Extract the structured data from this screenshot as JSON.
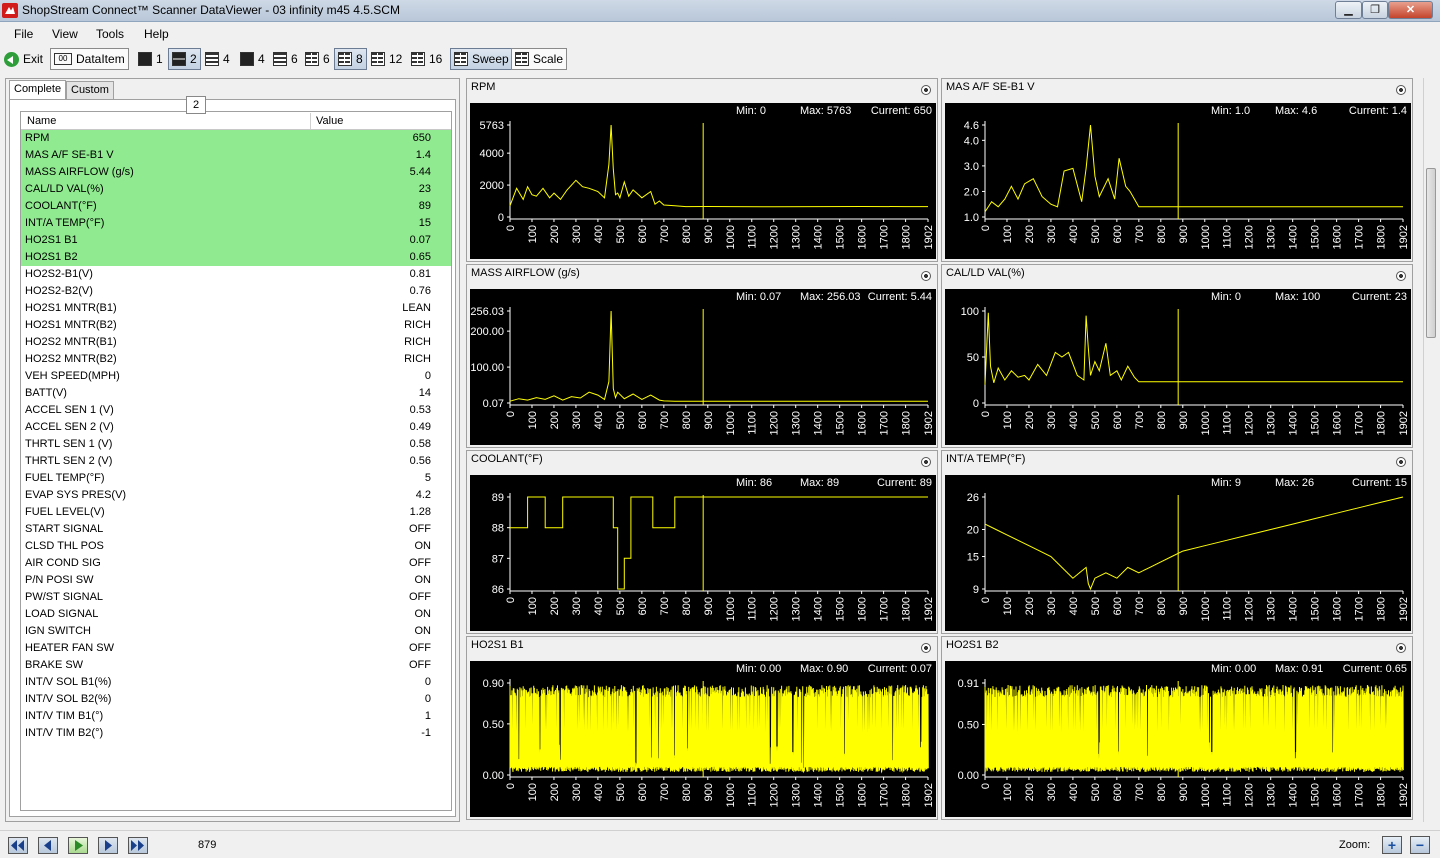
{
  "window": {
    "title": "ShopStream Connect™ Scanner DataViewer - 03 infinity m45 4.5.SCM",
    "min": "▁",
    "max": "❐",
    "close": "✕"
  },
  "menu": [
    "File",
    "View",
    "Tools",
    "Help"
  ],
  "toolbar": {
    "exit": "Exit",
    "dataitem": "DataItem",
    "layouts": [
      "1",
      "2",
      "4",
      "4",
      "6",
      "6",
      "8",
      "12",
      "16"
    ],
    "sweep": "Sweep",
    "scale": "Scale"
  },
  "tabs": {
    "complete": "Complete",
    "custom": "Custom",
    "badge": "2"
  },
  "grid": {
    "header_name": "Name",
    "header_value": "Value",
    "rows": [
      {
        "name": "RPM",
        "value": "650",
        "selected": true
      },
      {
        "name": "MAS A/F SE-B1 V",
        "value": "1.4",
        "selected": true
      },
      {
        "name": "MASS AIRFLOW (g/s)",
        "value": "5.44",
        "selected": true
      },
      {
        "name": "CAL/LD VAL(%)",
        "value": "23",
        "selected": true
      },
      {
        "name": "COOLANT(°F)",
        "value": "89",
        "selected": true
      },
      {
        "name": "INT/A TEMP(°F)",
        "value": "15",
        "selected": true
      },
      {
        "name": "HO2S1 B1",
        "value": "0.07",
        "selected": true
      },
      {
        "name": "HO2S1 B2",
        "value": "0.65",
        "selected": true
      },
      {
        "name": "HO2S2-B1(V)",
        "value": "0.81",
        "selected": false
      },
      {
        "name": "HO2S2-B2(V)",
        "value": "0.76",
        "selected": false
      },
      {
        "name": "HO2S1 MNTR(B1)",
        "value": "LEAN",
        "selected": false
      },
      {
        "name": "HO2S1 MNTR(B2)",
        "value": "RICH",
        "selected": false
      },
      {
        "name": "HO2S2 MNTR(B1)",
        "value": "RICH",
        "selected": false
      },
      {
        "name": "HO2S2 MNTR(B2)",
        "value": "RICH",
        "selected": false
      },
      {
        "name": "VEH SPEED(MPH)",
        "value": "0",
        "selected": false
      },
      {
        "name": "BATT(V)",
        "value": "14",
        "selected": false
      },
      {
        "name": "ACCEL SEN 1 (V)",
        "value": "0.53",
        "selected": false
      },
      {
        "name": "ACCEL SEN 2 (V)",
        "value": "0.49",
        "selected": false
      },
      {
        "name": "THRTL SEN 1 (V)",
        "value": "0.58",
        "selected": false
      },
      {
        "name": "THRTL SEN 2 (V)",
        "value": "0.56",
        "selected": false
      },
      {
        "name": "FUEL TEMP(°F)",
        "value": "5",
        "selected": false
      },
      {
        "name": "EVAP SYS PRES(V)",
        "value": "4.2",
        "selected": false
      },
      {
        "name": "FUEL LEVEL(V)",
        "value": "1.28",
        "selected": false
      },
      {
        "name": "START SIGNAL",
        "value": "OFF",
        "selected": false
      },
      {
        "name": "CLSD THL POS",
        "value": "ON",
        "selected": false
      },
      {
        "name": "AIR COND SIG",
        "value": "OFF",
        "selected": false
      },
      {
        "name": "P/N POSI SW",
        "value": "ON",
        "selected": false
      },
      {
        "name": "PW/ST SIGNAL",
        "value": "OFF",
        "selected": false
      },
      {
        "name": "LOAD SIGNAL",
        "value": "ON",
        "selected": false
      },
      {
        "name": "IGN SWITCH",
        "value": "ON",
        "selected": false
      },
      {
        "name": "HEATER FAN SW",
        "value": "OFF",
        "selected": false
      },
      {
        "name": "BRAKE SW",
        "value": "OFF",
        "selected": false
      },
      {
        "name": "INT/V SOL B1(%)",
        "value": "0",
        "selected": false
      },
      {
        "name": "INT/V SOL B2(%)",
        "value": "0",
        "selected": false
      },
      {
        "name": "INT/V TIM B1(°)",
        "value": "1",
        "selected": false
      },
      {
        "name": "INT/V TIM B2(°)",
        "value": "-1",
        "selected": false
      }
    ]
  },
  "status": {
    "position": "879",
    "zoom_label": "Zoom:",
    "zoom_in": "+",
    "zoom_out": "−"
  },
  "colors": {
    "trace": "#ffff00",
    "selected_row": "#90ea90",
    "graph_bg": "#000000"
  },
  "chart_data": [
    {
      "type": "line",
      "title": "RPM",
      "stats": {
        "min": "Min: 0",
        "max": "Max: 5763",
        "current": "Current: 650"
      },
      "yticks": [
        "0",
        "2000",
        "4000",
        "5763"
      ],
      "ytick_values": [
        0,
        2000,
        4000,
        5763
      ],
      "ylim": [
        0,
        5763
      ],
      "xticks": [
        "0",
        "100",
        "200",
        "300",
        "400",
        "500",
        "600",
        "700",
        "800",
        "900",
        "1000",
        "1100",
        "1200",
        "1300",
        "1400",
        "1500",
        "1600",
        "1700",
        "1800",
        "1902"
      ],
      "xlim": [
        0,
        1902
      ],
      "cursor": 879,
      "x": [
        0,
        30,
        60,
        80,
        100,
        120,
        150,
        180,
        200,
        230,
        260,
        300,
        330,
        360,
        400,
        430,
        450,
        460,
        470,
        480,
        490,
        500,
        520,
        540,
        560,
        600,
        640,
        660,
        680,
        700,
        750,
        800,
        900,
        1000,
        1200,
        1400,
        1600,
        1800,
        1902
      ],
      "y": [
        700,
        1800,
        1100,
        1900,
        1400,
        1300,
        1800,
        1200,
        1500,
        1100,
        1700,
        2300,
        1900,
        1800,
        1600,
        1200,
        3300,
        5763,
        3000,
        1400,
        1500,
        1200,
        2200,
        1300,
        1700,
        1200,
        1600,
        800,
        1000,
        750,
        700,
        650,
        660,
        650,
        640,
        650,
        655,
        650,
        650
      ]
    },
    {
      "type": "line",
      "title": "MAS A/F SE-B1 V",
      "stats": {
        "min": "Min: 1.0",
        "max": "Max: 4.6",
        "current": "Current: 1.4"
      },
      "yticks": [
        "1.0",
        "2.0",
        "3.0",
        "4.0",
        "4.6"
      ],
      "ytick_values": [
        1.0,
        2.0,
        3.0,
        4.0,
        4.6
      ],
      "ylim": [
        1.0,
        4.6
      ],
      "xticks": [
        "0",
        "100",
        "200",
        "300",
        "400",
        "500",
        "600",
        "700",
        "800",
        "900",
        "1000",
        "1100",
        "1200",
        "1300",
        "1400",
        "1500",
        "1600",
        "1700",
        "1800",
        "1902"
      ],
      "xlim": [
        0,
        1902
      ],
      "cursor": 879,
      "x": [
        0,
        30,
        60,
        90,
        120,
        150,
        180,
        220,
        260,
        300,
        330,
        360,
        400,
        440,
        460,
        480,
        500,
        520,
        560,
        590,
        610,
        640,
        660,
        700,
        750,
        800,
        900,
        1100,
        1300,
        1500,
        1700,
        1902
      ],
      "y": [
        1.2,
        1.6,
        1.4,
        1.7,
        2.2,
        1.7,
        2.3,
        2.5,
        1.8,
        1.5,
        1.4,
        2.8,
        2.9,
        1.6,
        2.9,
        4.6,
        2.6,
        1.8,
        2.5,
        1.7,
        3.3,
        2.2,
        2.0,
        1.4,
        1.4,
        1.4,
        1.4,
        1.4,
        1.4,
        1.4,
        1.4,
        1.4
      ]
    },
    {
      "type": "line",
      "title": "MASS AIRFLOW (g/s)",
      "stats": {
        "min": "Min: 0.07",
        "max": "Max: 256.03",
        "current": "Current: 5.44"
      },
      "yticks": [
        "0.07",
        "100.00",
        "200.00",
        "256.03"
      ],
      "ytick_values": [
        0.07,
        100,
        200,
        256.03
      ],
      "ylim": [
        0.07,
        256.03
      ],
      "xticks": [
        "0",
        "100",
        "200",
        "300",
        "400",
        "500",
        "600",
        "700",
        "800",
        "900",
        "1000",
        "1100",
        "1200",
        "1300",
        "1400",
        "1500",
        "1600",
        "1700",
        "1800",
        "1902"
      ],
      "xlim": [
        0,
        1902
      ],
      "cursor": 879,
      "x": [
        0,
        40,
        80,
        120,
        160,
        200,
        240,
        280,
        320,
        360,
        400,
        430,
        450,
        460,
        470,
        480,
        490,
        520,
        560,
        600,
        640,
        680,
        700,
        750,
        800,
        900,
        1100,
        1300,
        1500,
        1700,
        1902
      ],
      "y": [
        5,
        12,
        8,
        15,
        10,
        20,
        8,
        18,
        14,
        30,
        22,
        10,
        60,
        256,
        40,
        15,
        30,
        12,
        25,
        10,
        22,
        8,
        6,
        5,
        5,
        5,
        5,
        5,
        5,
        5,
        5
      ]
    },
    {
      "type": "line",
      "title": "CAL/LD VAL(%)",
      "stats": {
        "min": "Min: 0",
        "max": "Max: 100",
        "current": "Current: 23"
      },
      "yticks": [
        "0",
        "50",
        "100"
      ],
      "ytick_values": [
        0,
        50,
        100
      ],
      "ylim": [
        0,
        100
      ],
      "xticks": [
        "0",
        "100",
        "200",
        "300",
        "400",
        "500",
        "600",
        "700",
        "800",
        "900",
        "1000",
        "1100",
        "1200",
        "1300",
        "1400",
        "1500",
        "1600",
        "1700",
        "1800",
        "1902"
      ],
      "xlim": [
        0,
        1902
      ],
      "cursor": 879,
      "x": [
        0,
        15,
        25,
        40,
        60,
        90,
        120,
        150,
        180,
        200,
        240,
        280,
        320,
        350,
        380,
        420,
        450,
        460,
        470,
        480,
        500,
        520,
        550,
        570,
        600,
        620,
        650,
        680,
        700,
        750,
        800,
        900,
        1100,
        1300,
        1500,
        1700,
        1902
      ],
      "y": [
        20,
        98,
        40,
        22,
        38,
        25,
        35,
        28,
        30,
        25,
        42,
        30,
        55,
        50,
        55,
        30,
        25,
        95,
        60,
        30,
        45,
        35,
        65,
        30,
        35,
        25,
        40,
        28,
        23,
        23,
        23,
        23,
        23,
        23,
        23,
        23,
        23
      ]
    },
    {
      "type": "line",
      "title": "COOLANT(°F)",
      "stats": {
        "min": "Min: 86",
        "max": "Max: 89",
        "current": "Current: 89"
      },
      "yticks": [
        "86",
        "87",
        "88",
        "89"
      ],
      "ytick_values": [
        86,
        87,
        88,
        89
      ],
      "ylim": [
        86,
        89
      ],
      "xticks": [
        "0",
        "100",
        "200",
        "300",
        "400",
        "500",
        "600",
        "700",
        "800",
        "900",
        "1000",
        "1100",
        "1200",
        "1300",
        "1400",
        "1500",
        "1600",
        "1700",
        "1800",
        "1902"
      ],
      "xlim": [
        0,
        1902
      ],
      "cursor": 879,
      "x": [
        0,
        80,
        80,
        160,
        160,
        240,
        240,
        470,
        470,
        490,
        490,
        520,
        520,
        550,
        550,
        650,
        650,
        750,
        750,
        900,
        1100,
        1300,
        1500,
        1700,
        1902
      ],
      "y": [
        88,
        88,
        89,
        89,
        88,
        88,
        89,
        89,
        88,
        88,
        86,
        86,
        87,
        87,
        89,
        89,
        88,
        88,
        89,
        89,
        89,
        89,
        89,
        89,
        89
      ]
    },
    {
      "type": "line",
      "title": "INT/A TEMP(°F)",
      "stats": {
        "min": "Min: 9",
        "max": "Max: 26",
        "current": "Current: 15"
      },
      "yticks": [
        "9",
        "15",
        "20",
        "26"
      ],
      "ytick_values": [
        9,
        15,
        20,
        26
      ],
      "ylim": [
        9,
        26
      ],
      "xticks": [
        "0",
        "100",
        "200",
        "300",
        "400",
        "500",
        "600",
        "700",
        "800",
        "900",
        "1000",
        "1100",
        "1200",
        "1300",
        "1400",
        "1500",
        "1600",
        "1700",
        "1800",
        "1902"
      ],
      "xlim": [
        0,
        1902
      ],
      "cursor": 879,
      "x": [
        0,
        50,
        100,
        150,
        200,
        250,
        300,
        350,
        400,
        430,
        460,
        470,
        480,
        500,
        550,
        600,
        650,
        700,
        750,
        800,
        850,
        900,
        1000,
        1100,
        1200,
        1300,
        1400,
        1500,
        1600,
        1700,
        1800,
        1902
      ],
      "y": [
        21,
        20,
        19,
        18,
        17,
        16,
        15,
        13,
        11,
        12,
        13,
        10,
        9,
        11,
        12,
        11,
        13,
        12,
        13,
        14,
        15,
        16,
        17,
        18,
        19,
        20,
        21,
        22,
        23,
        24,
        25,
        26
      ]
    },
    {
      "type": "line",
      "title": "HO2S1 B1",
      "stats": {
        "min": "Min: 0.00",
        "max": "Max: 0.90",
        "current": "Current: 0.07"
      },
      "yticks": [
        "0.00",
        "0.50",
        "0.90"
      ],
      "ytick_values": [
        0,
        0.5,
        0.9
      ],
      "ylim": [
        0,
        0.9
      ],
      "xticks": [
        "0",
        "100",
        "200",
        "300",
        "400",
        "500",
        "600",
        "700",
        "800",
        "900",
        "1000",
        "1100",
        "1200",
        "1300",
        "1400",
        "1500",
        "1600",
        "1700",
        "1800",
        "1902"
      ],
      "xlim": [
        0,
        1902
      ],
      "cursor": 879,
      "oscillating": true,
      "osc_low": 0.03,
      "osc_high": 0.88
    },
    {
      "type": "line",
      "title": "HO2S1 B2",
      "stats": {
        "min": "Min: 0.00",
        "max": "Max: 0.91",
        "current": "Current: 0.65"
      },
      "yticks": [
        "0.00",
        "0.50",
        "0.91"
      ],
      "ytick_values": [
        0,
        0.5,
        0.91
      ],
      "ylim": [
        0,
        0.91
      ],
      "xticks": [
        "0",
        "100",
        "200",
        "300",
        "400",
        "500",
        "600",
        "700",
        "800",
        "900",
        "1000",
        "1100",
        "1200",
        "1300",
        "1400",
        "1500",
        "1600",
        "1700",
        "1800",
        "1902"
      ],
      "xlim": [
        0,
        1902
      ],
      "cursor": 879,
      "oscillating": true,
      "osc_low": 0.03,
      "osc_high": 0.89
    }
  ]
}
